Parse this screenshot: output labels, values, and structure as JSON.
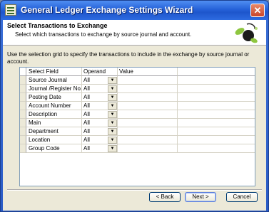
{
  "window": {
    "title": "General Ledger Exchange Settings Wizard"
  },
  "header": {
    "title": "Select Transactions to Exchange",
    "subtitle": "Select which transactions to exchange by source journal and account."
  },
  "instructions": "Use the selection grid to specify the transactions to include in the exchange by source journal or account.",
  "grid": {
    "columns": [
      "Select Field",
      "Operand",
      "Value"
    ],
    "rows": [
      {
        "field": "Source Journal",
        "operand": "All",
        "value": ""
      },
      {
        "field": "Journal /Register No.",
        "operand": "All",
        "value": ""
      },
      {
        "field": "Posting Date",
        "operand": "All",
        "value": ""
      },
      {
        "field": "Account Number",
        "operand": "All",
        "value": ""
      },
      {
        "field": "Description",
        "operand": "All",
        "value": ""
      },
      {
        "field": "Main",
        "operand": "All",
        "value": ""
      },
      {
        "field": "Department",
        "operand": "All",
        "value": ""
      },
      {
        "field": "Location",
        "operand": "All",
        "value": ""
      },
      {
        "field": "Group Code",
        "operand": "All",
        "value": ""
      }
    ]
  },
  "buttons": {
    "back": "< Back",
    "next": "Next >",
    "cancel": "Cancel"
  },
  "icons": {
    "close": "close-icon",
    "app": "ledger-icon",
    "logo": "wizard-logo",
    "dropdown": "chevron-down-icon"
  }
}
